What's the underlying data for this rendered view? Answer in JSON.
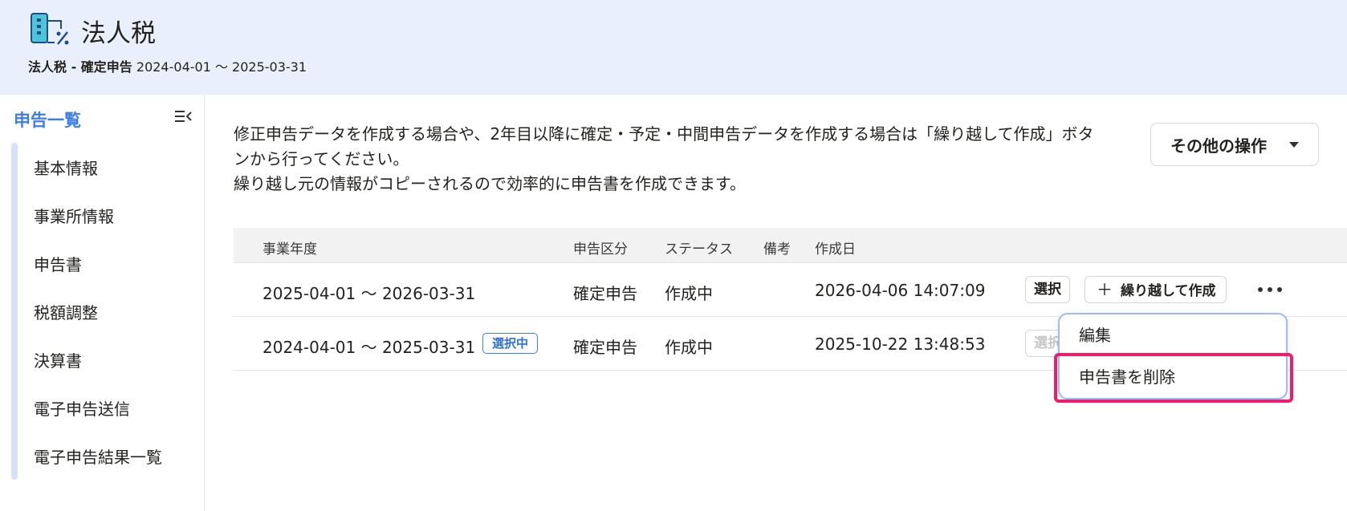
{
  "header": {
    "app_title": "法人税",
    "subtitle_bold": "法人税 - 確定申告",
    "subtitle_period": "2024-04-01 〜 2025-03-31"
  },
  "sidebar": {
    "title": "申告一覧",
    "items": [
      {
        "label": "基本情報"
      },
      {
        "label": "事業所情報"
      },
      {
        "label": "申告書"
      },
      {
        "label": "税額調整"
      },
      {
        "label": "決算書"
      },
      {
        "label": "電子申告送信"
      },
      {
        "label": "電子申告結果一覧"
      }
    ]
  },
  "main": {
    "notice_line1": "修正申告データを作成する場合や、2年目以降に確定・予定・中間申告データを作成する場合は「繰り越して作成」ボタンから行ってください。",
    "notice_line2": "繰り越し元の情報がコピーされるので効率的に申告書を作成できます。",
    "other_actions_label": "その他の操作"
  },
  "table": {
    "columns": [
      "事業年度",
      "申告区分",
      "ステータス",
      "備考",
      "作成日"
    ],
    "rows": [
      {
        "period": "2025-04-01 〜 2026-03-31",
        "type": "確定申告",
        "status": "作成中",
        "note": "",
        "created": "2026-04-06 14:07:09",
        "select_label": "選択",
        "carry_label": "繰り越して作成"
      },
      {
        "period": "2024-04-01 〜 2025-03-31",
        "badge": "選択中",
        "type": "確定申告",
        "status": "作成中",
        "note": "",
        "created": "2025-10-22 13:48:53",
        "select_label": "選択"
      }
    ],
    "carry_plus": "＋"
  },
  "menu": {
    "items": [
      {
        "label": "編集"
      },
      {
        "label": "申告書を削除"
      }
    ]
  },
  "colors": {
    "header_bg": "#eaf0fb",
    "accent": "#3b7de9",
    "highlight": "#ef1c6a"
  }
}
